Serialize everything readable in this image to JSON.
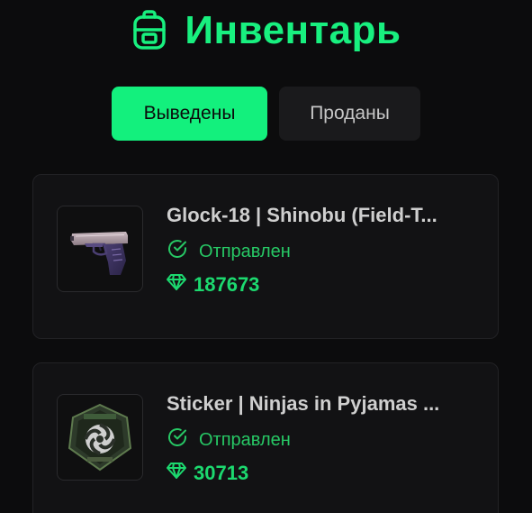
{
  "header": {
    "title": "Инвентарь",
    "icon": "backpack-icon"
  },
  "tabs": [
    {
      "label": "Выведены",
      "active": true
    },
    {
      "label": "Проданы",
      "active": false
    }
  ],
  "items": [
    {
      "title": "Glock-18 | Shinobu (Field-T...",
      "status": "Отправлен",
      "status_icon": "check-circle-icon",
      "price": "187673",
      "price_icon": "diamond-icon",
      "image": "pistol-image"
    },
    {
      "title": "Sticker | Ninjas in Pyjamas ...",
      "status": "Отправлен",
      "status_icon": "check-circle-icon",
      "price": "30713",
      "price_icon": "diamond-icon",
      "image": "sticker-image"
    }
  ],
  "colors": {
    "accent": "#13f07d",
    "background": "#0c0c0d",
    "card": "#121214",
    "status": "#27c865"
  }
}
